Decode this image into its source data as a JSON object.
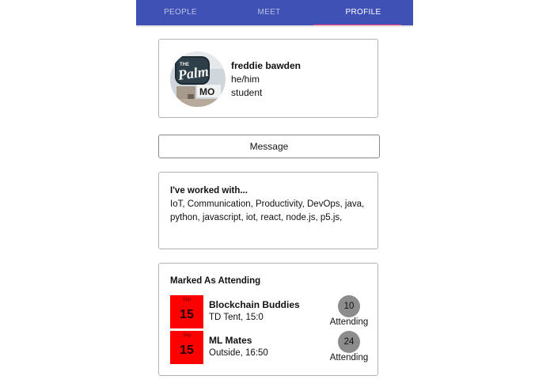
{
  "tabs": {
    "people": "PEOPLE",
    "meet": "MEET",
    "profile": "PROFILE",
    "active": "profile"
  },
  "colors": {
    "tab_bar": "#3f51b5",
    "tab_indicator": "#ff4081",
    "event_date": "#ff0000",
    "count_badge": "#8c8c8c"
  },
  "profile": {
    "name": "freddie bawden",
    "pronouns": "he/him",
    "role": "student",
    "avatar_text_top": "THE",
    "avatar_text_main": "Palm",
    "avatar_text_sign": "MO"
  },
  "message_button": "Message",
  "skills": {
    "title": "I've worked with...",
    "text": "IoT, Communication, Productivity, DevOps, java, python, javascript, iot, react, node.js, p5.js,"
  },
  "attending": {
    "title": "Marked As Attending",
    "events": [
      {
        "month": "Sep",
        "day": "15",
        "name": "Blockchain Buddies",
        "location": "TD Tent, 15:0",
        "count": "10",
        "count_label": "Attending"
      },
      {
        "month": "Sep",
        "day": "15",
        "name": "ML Mates",
        "location": "Outside, 16:50",
        "count": "24",
        "count_label": "Attending"
      }
    ]
  }
}
